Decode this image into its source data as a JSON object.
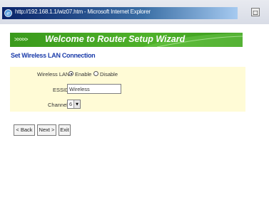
{
  "window": {
    "title": "http://192.168.1.1/wiz07.htm - Microsoft Internet Explorer",
    "maximize_glyph": "□"
  },
  "banner": {
    "arrows": ">>>>>",
    "title": "Welcome to Router Setup Wizard"
  },
  "page": {
    "subtitle": "Set Wireless LAN Connection"
  },
  "form": {
    "wireless_lan": {
      "label": "Wireless LAN",
      "enable_label": "Enable",
      "disable_label": "Disable",
      "selected": "Enable"
    },
    "essid": {
      "label": "ESSID",
      "value": "Wireless"
    },
    "channel": {
      "label": "Channel",
      "value": "6",
      "arrow": "▼"
    }
  },
  "buttons": {
    "back": "< Back",
    "next": "Next >",
    "exit": "Exit"
  },
  "colors": {
    "banner_green": "#4fb12a",
    "subtitle_blue": "#1b3caa",
    "panel_yellow": "#fffbd6"
  }
}
